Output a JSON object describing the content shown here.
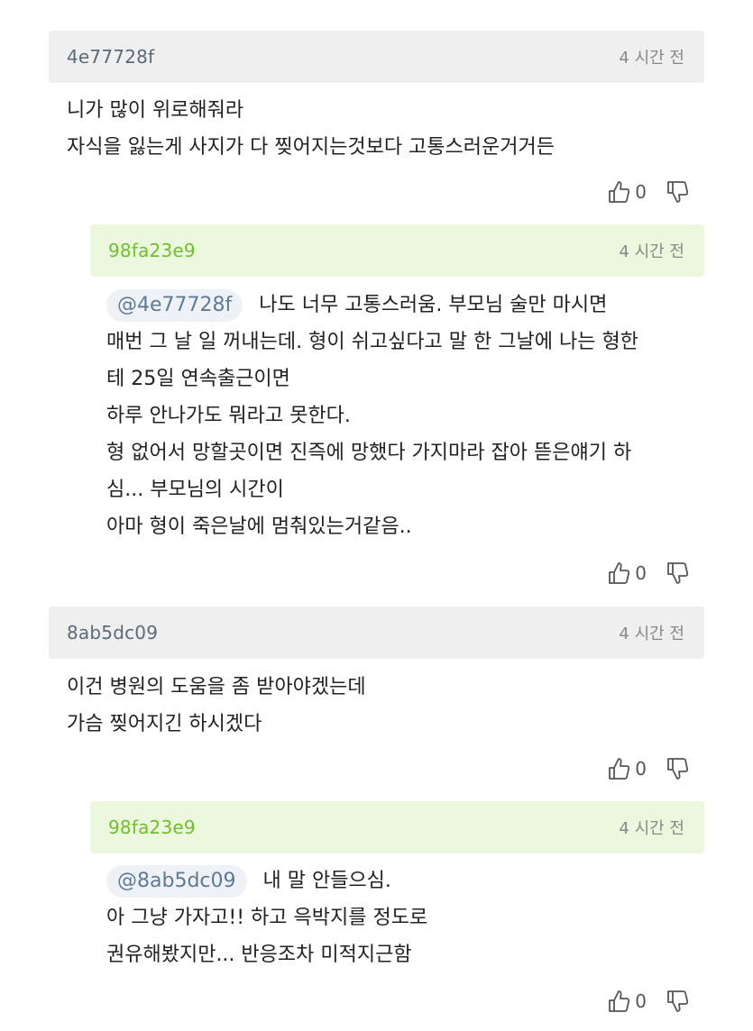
{
  "comments": [
    {
      "author": "4e77728f",
      "time": "4 시간 전",
      "mention": "",
      "lines": [
        "니가 많이 위로해줘라",
        "자식을 잃는게 사지가 다 찢어지는것보다 고통스러운거거든"
      ],
      "upvotes": "0"
    },
    {
      "author": "98fa23e9",
      "time": "4 시간 전",
      "mention": "@4e77728f",
      "lines": [
        "나도 너무 고통스러움. 부모님 술만 마시면",
        "매번 그 날 일 꺼내는데. 형이 쉬고싶다고 말 한 그날에 나는 형한",
        "테 25일 연속출근이면",
        "하루 안나가도 뭐라고 못한다.",
        "형 없어서 망할곳이면 진즉에 망했다 가지마라 잡아 뜯은얘기 하",
        "심... 부모님의 시간이",
        "아마 형이 죽은날에 멈춰있는거같음.."
      ],
      "upvotes": "0"
    },
    {
      "author": "8ab5dc09",
      "time": "4 시간 전",
      "mention": "",
      "lines": [
        "이건 병원의 도움을 좀 받아야겠는데",
        "가슴 찢어지긴 하시겠다"
      ],
      "upvotes": "0"
    },
    {
      "author": "98fa23e9",
      "time": "4 시간 전",
      "mention": "@8ab5dc09",
      "lines": [
        "내 말 안들으심.",
        "아 그냥 가자고!! 하고 윽박지를 정도로",
        "권유해봤지만... 반응조차 미적지근함"
      ],
      "upvotes": "0"
    }
  ],
  "icons": {
    "upvote": "thumbs-up-outline",
    "downvote": "thumbs-down-outline"
  },
  "colors": {
    "reply_author": "#6fbf2a",
    "comment_author": "#5b6b78",
    "reply_header_bg": "#ebf8de",
    "comment_header_bg": "#efefef"
  }
}
